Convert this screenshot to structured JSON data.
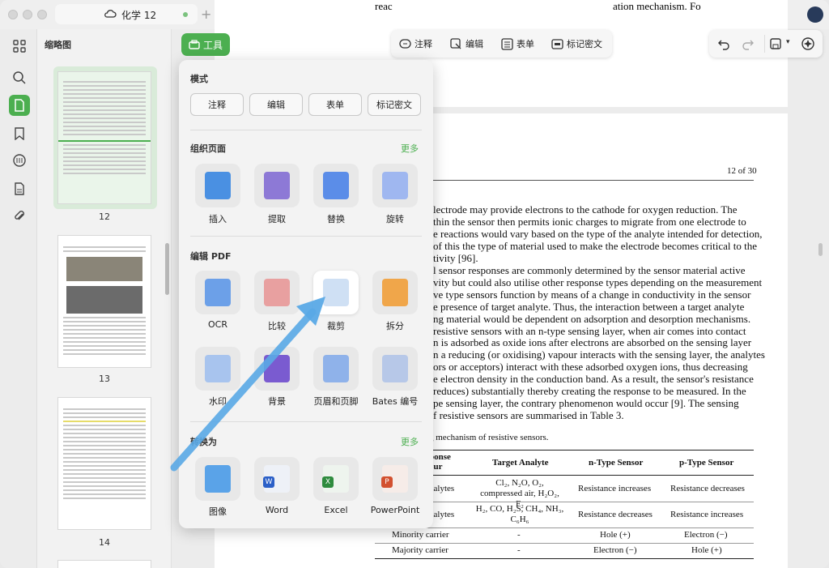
{
  "window": {
    "tab_title": "化学 12"
  },
  "sidebar": {
    "header": "缩略图",
    "pages": [
      "12",
      "13",
      "14"
    ]
  },
  "toolbar": {
    "tools_label": "工具",
    "annotate": "注释",
    "edit": "编辑",
    "form": "表单",
    "redact": "标记密文"
  },
  "popup": {
    "mode_title": "模式",
    "modes": [
      "注释",
      "编辑",
      "表单",
      "标记密文"
    ],
    "organize_title": "组织页面",
    "organize_more": "更多",
    "organize_items": [
      "插入",
      "提取",
      "替换",
      "旋转"
    ],
    "edit_title": "编辑 PDF",
    "edit_items_row1": [
      "OCR",
      "比较",
      "裁剪",
      "拆分"
    ],
    "edit_items_row2": [
      "水印",
      "背景",
      "页眉和页脚",
      "Bates 编号"
    ],
    "convert_title": "转换为",
    "convert_more": "更多",
    "convert_items": [
      "图像",
      "Word",
      "Excel",
      "PowerPoint"
    ]
  },
  "document": {
    "top_line_left": "reac",
    "top_line_right": "ation mechanism.  Fo",
    "page_number": "12 of 30",
    "body_lines": [
      "lectrode may provide electrons to the cathode for oxygen reduction.  The",
      "thin the sensor then permits ionic charges to migrate from one electrode to",
      "e reactions would vary based on the type of the analyte intended for detection,",
      "of this the type of material used to make the electrode becomes critical to the",
      "tivity [96].",
      "l sensor responses are commonly determined by the sensor material active",
      "vity but could also utilise other response types depending on the measurement",
      "ve type sensors function by means of a change in conductivity in the sensor",
      "e presence of target analyte. Thus, the interaction between a target analyte",
      "ng material would be dependent on adsorption and desorption mechanisms.",
      "resistive sensors with an n-type sensing layer, when air comes into contact",
      "n is adsorbed as oxide ions after electrons are absorbed on the sensing layer",
      "n a reducing (or oxidising) vapour interacts with the sensing layer, the analytes",
      "ors or acceptors) interact with these adsorbed oxygen ions, thus decreasing",
      "e electron density in the conduction band.  As a result, the sensor's resistance",
      "reduces) substantially thereby creating the response to be measured. In the",
      "pe sensing layer, the contrary phenomenon would occur [9].  The sensing",
      "f resistive sensors are summarised in Table 3."
    ],
    "table_caption": "g mechanism of resistive sensors.",
    "table": {
      "headers": [
        "ponse\nour",
        "Target Analyte",
        "n-Type Sensor",
        "p-Type Sensor"
      ],
      "rows": [
        [
          "nalytes",
          "Cl₂, N₂O, O₂, compressed air, H₂O₂, F₂",
          "Resistance increases",
          "Resistance decreases"
        ],
        [
          "nalytes",
          "H₂, CO, H₂S, CH₄, NH₃, C₆H₆",
          "Resistance decreases",
          "Resistance increases"
        ],
        [
          "Minority carrier",
          "-",
          "Hole (+)",
          "Electron (−)"
        ],
        [
          "Majority carrier",
          "-",
          "Electron (−)",
          "Hole (+)"
        ]
      ]
    }
  },
  "colors": {
    "accent": "#4caf50",
    "arrow": "#5aa9e6"
  }
}
